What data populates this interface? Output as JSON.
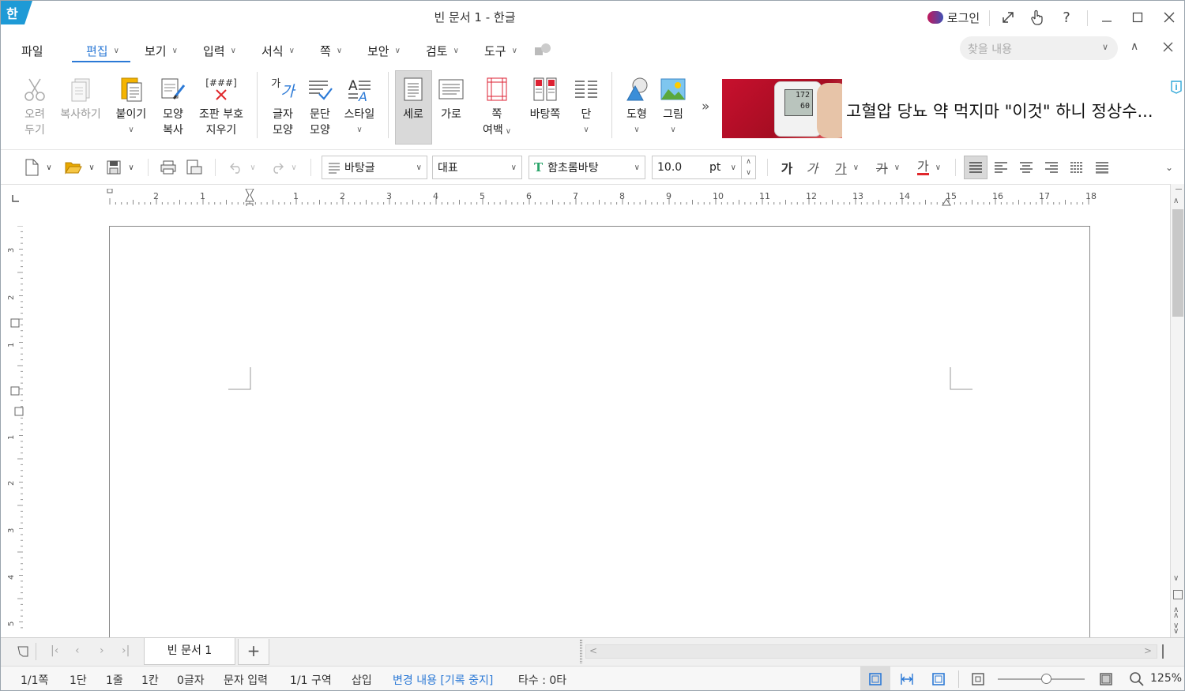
{
  "window": {
    "title": "빈 문서 1 - 한글",
    "app_logo": "한",
    "login_label": "로그인"
  },
  "menu": {
    "file": "파일",
    "tabs": [
      "편집",
      "보기",
      "입력",
      "서식",
      "쪽",
      "보안",
      "검토",
      "도구"
    ],
    "active": "편집",
    "search_placeholder": "찾을 내용"
  },
  "ribbon": {
    "cut": [
      "오려",
      "두기"
    ],
    "copy": "복사하기",
    "paste": "붙이기",
    "format_copy": [
      "모양",
      "복사"
    ],
    "clear_markup": [
      "조판 부호",
      "지우기"
    ],
    "clear_markup_icon_text": "[###]",
    "char_shape": [
      "글자",
      "모양"
    ],
    "char_shape_icon_text": [
      "가",
      "가"
    ],
    "para_shape": [
      "문단",
      "모양"
    ],
    "style": "스타일",
    "portrait": "세로",
    "landscape": "가로",
    "margins": [
      "쪽",
      "여백"
    ],
    "master_page": "바탕쪽",
    "columns": "단",
    "shape": "도형",
    "picture": "그림",
    "more": "»",
    "ad_text": "고혈압 당뇨 약 먹지마 \"이것\" 하니 정상수...",
    "ad_screen_values": [
      "172",
      "60"
    ]
  },
  "toolbar": {
    "style_value": "바탕글",
    "language_value": "대표",
    "font_value": "함초롬바탕",
    "font_icon": "T",
    "size_value": "10.0",
    "size_unit": "pt",
    "char_buttons": [
      "가",
      "가",
      "가",
      "가",
      "가"
    ]
  },
  "ruler": {
    "h_ticks": [
      "2",
      "1",
      "1",
      "2",
      "3",
      "4",
      "5",
      "6",
      "7",
      "8",
      "9",
      "10",
      "11",
      "12",
      "13",
      "14",
      "15",
      "16",
      "17",
      "18"
    ],
    "v_ticks": [
      "3",
      "2",
      "1",
      "1",
      "2",
      "3",
      "4",
      "5"
    ]
  },
  "tabs": {
    "doc_tab": "빈 문서 1",
    "add": "+"
  },
  "status": {
    "page": "1/1쪽",
    "column": "1단",
    "line": "1줄",
    "col": "1칸",
    "chars": "0글자",
    "mode": "문자 입력",
    "section": "1/1 구역",
    "insert": "삽입",
    "track_changes": "변경 내용 [기록 중지]",
    "typing": "타수 : 0타",
    "zoom": "125%",
    "zoom_level": 0.55
  },
  "colors": {
    "accent": "#2b79d6",
    "logo": "#1e9ad6",
    "font_icon": "#2aa56a",
    "text_color_bar": "#e0272b"
  }
}
